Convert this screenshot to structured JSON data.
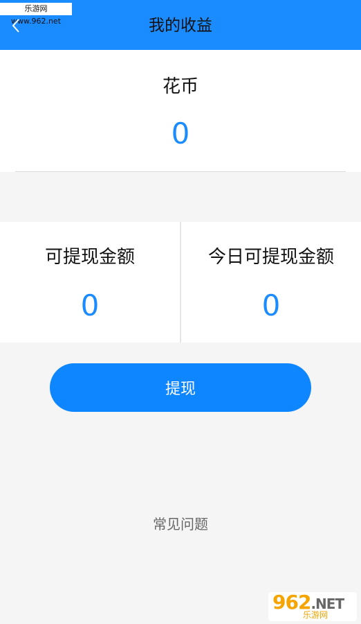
{
  "watermark": "乐游网 www.962.net",
  "header": {
    "title": "我的收益",
    "back_icon": "chevron-left-icon",
    "bg_color": "#1a8cff"
  },
  "coins": {
    "label": "花币",
    "value": "0"
  },
  "amounts": {
    "withdrawable_label": "可提现金额",
    "withdrawable_value": "0",
    "today_label": "今日可提现金额",
    "today_value": "0"
  },
  "withdraw_button": {
    "label": "提现",
    "color": "#0d86ff"
  },
  "faq": {
    "label": "常见问题"
  },
  "logo": {
    "brand": "962",
    "suffix": ".NET",
    "sub": "乐游网"
  },
  "accent_color": "#1a8cff"
}
